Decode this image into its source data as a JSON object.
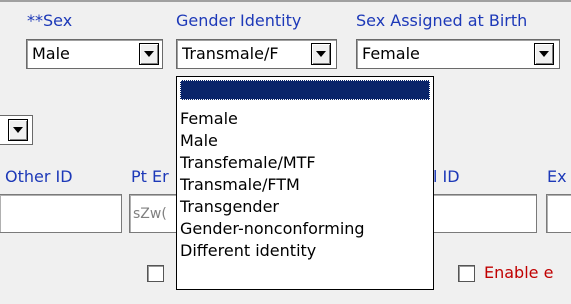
{
  "labels": {
    "sex": "**Sex",
    "gender_identity": "Gender Identity",
    "sex_at_birth": "Sex Assigned at Birth",
    "other_id": "Other ID",
    "pt_email": "Pt Er",
    "ext_id": "l ID",
    "ex": "Ex",
    "enable": "Enable e"
  },
  "combos": {
    "sex": "Male",
    "gender_identity": "Transmale/F",
    "sex_at_birth": "Female"
  },
  "fields": {
    "pt_email_value": "sZw("
  },
  "gender_identity_options": [
    "",
    "Female",
    "Male",
    "Transfemale/MTF",
    "Transmale/FTM",
    "Transgender",
    "Gender-nonconforming",
    "Different identity"
  ],
  "selected_option_index": 0,
  "colors": {
    "label_blue": "#1d39b8",
    "enable_red": "#c00000",
    "highlight": "#0a246a"
  }
}
